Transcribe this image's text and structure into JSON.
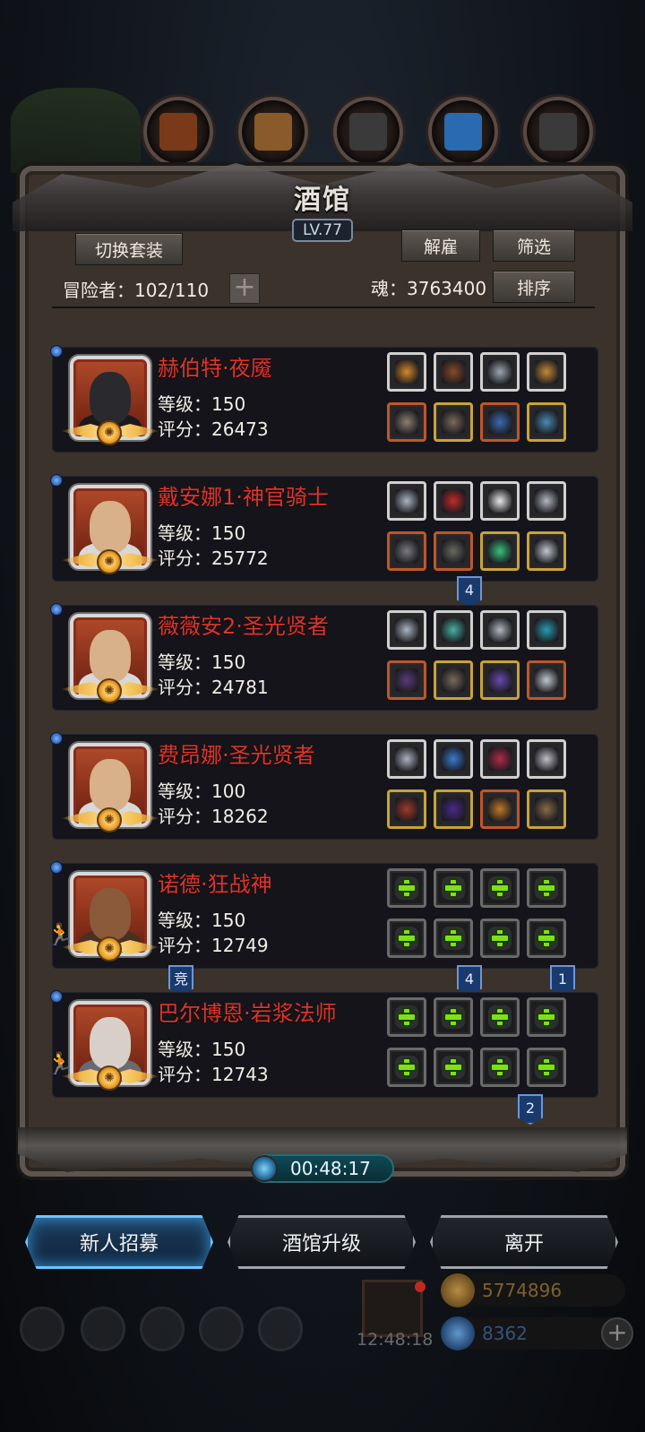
{
  "tavern": {
    "title": "酒馆",
    "level": "LV.77",
    "switch_outfit_label": "切换套装",
    "dismiss_label": "解雇",
    "filter_label": "筛选",
    "sort_label": "排序",
    "adventurers_label": "冒险者：102/110",
    "adventurers_current": 102,
    "adventurers_max": 110,
    "soul_label": "魂：3763400",
    "soul_value": 3763400
  },
  "heroes": [
    {
      "name": "赫伯特·夜魇",
      "level": "等级：150",
      "score": "评分：26473",
      "portrait": "masked-warrior",
      "equipment": [
        {
          "icon": "flame-helm-icon",
          "rarity": "white",
          "color": "#d48a2a"
        },
        {
          "icon": "armor-piece-icon",
          "rarity": "white",
          "color": "#8a4a2a"
        },
        {
          "icon": "crystal-ore-icon",
          "rarity": "white",
          "color": "#9aa6b0"
        },
        {
          "icon": "golden-staff-icon",
          "rarity": "white",
          "color": "#c48a3a"
        },
        {
          "icon": "curved-dagger-icon",
          "rarity": "red",
          "color": "#8a8070"
        },
        {
          "icon": "chest-armor-icon",
          "rarity": "yellow",
          "color": "#7a6a5a"
        },
        {
          "icon": "blue-blade-icon",
          "rarity": "red",
          "color": "#3a6ab0"
        },
        {
          "icon": "ring-icon",
          "rarity": "yellow",
          "color": "#4a8ab0"
        }
      ],
      "tags": []
    },
    {
      "name": "戴安娜1·神官骑士",
      "level": "等级：150",
      "score": "评分：25772",
      "portrait": "hooded-woman",
      "equipment": [
        {
          "icon": "silver-circlet-icon",
          "rarity": "white",
          "color": "#aab4c0"
        },
        {
          "icon": "red-orb-amulet-icon",
          "rarity": "white",
          "color": "#c02a2a"
        },
        {
          "icon": "white-wing-icon",
          "rarity": "white",
          "color": "#e8e8e8"
        },
        {
          "icon": "silver-dagger-icon",
          "rarity": "white",
          "color": "#b0b8c0"
        },
        {
          "icon": "war-hammer-icon",
          "rarity": "red",
          "color": "#7a7a80"
        },
        {
          "icon": "gauntlet-icon",
          "rarity": "red",
          "color": "#6a6a60"
        },
        {
          "icon": "emerald-ring-icon",
          "rarity": "yellow",
          "color": "#3ac07a"
        },
        {
          "icon": "pendant-icon",
          "rarity": "yellow",
          "color": "#c0c8d0"
        }
      ],
      "tags": [
        "4"
      ]
    },
    {
      "name": "薇薇安2·圣光贤者",
      "level": "等级：150",
      "score": "评分：24781",
      "portrait": "hooded-woman",
      "equipment": [
        {
          "icon": "silver-circlet-icon",
          "rarity": "white",
          "color": "#aab4c0"
        },
        {
          "icon": "teal-gem-icon",
          "rarity": "white",
          "color": "#4ab0a0"
        },
        {
          "icon": "silver-dagger-icon",
          "rarity": "white",
          "color": "#b0b8c0"
        },
        {
          "icon": "teal-bracer-icon",
          "rarity": "white",
          "color": "#2a9ab0"
        },
        {
          "icon": "purple-hood-icon",
          "rarity": "red",
          "color": "#5a3a7a"
        },
        {
          "icon": "chest-armor-icon",
          "rarity": "yellow",
          "color": "#7a6a5a"
        },
        {
          "icon": "purple-orb-icon",
          "rarity": "yellow",
          "color": "#6a4ab0"
        },
        {
          "icon": "pendant-icon",
          "rarity": "red",
          "color": "#c0c8d0"
        }
      ],
      "tags": []
    },
    {
      "name": "费昂娜·圣光贤者",
      "level": "等级：100",
      "score": "评分：18262",
      "portrait": "hooded-woman",
      "equipment": [
        {
          "icon": "silver-circlet-icon",
          "rarity": "white",
          "color": "#aab4c0"
        },
        {
          "icon": "blue-flame-icon",
          "rarity": "white",
          "color": "#3a7ad0"
        },
        {
          "icon": "red-shard-icon",
          "rarity": "white",
          "color": "#b02a4a"
        },
        {
          "icon": "star-emblem-icon",
          "rarity": "white",
          "color": "#c0c0c8"
        },
        {
          "icon": "red-axe-icon",
          "rarity": "yellow",
          "color": "#a03a2a"
        },
        {
          "icon": "purple-armor-icon",
          "rarity": "yellow",
          "color": "#4a2a8a"
        },
        {
          "icon": "fire-gauntlet-icon",
          "rarity": "red",
          "color": "#c07a2a"
        },
        {
          "icon": "bronze-ring-icon",
          "rarity": "yellow",
          "color": "#8a6a4a"
        }
      ],
      "tags": []
    },
    {
      "name": "诺德·狂战神",
      "level": "等级：150",
      "score": "评分：12749",
      "portrait": "bald-brute",
      "equipment": [
        {
          "icon": "empty-slot-plus-icon",
          "rarity": "empty"
        },
        {
          "icon": "empty-slot-plus-icon",
          "rarity": "empty"
        },
        {
          "icon": "empty-slot-plus-icon",
          "rarity": "empty"
        },
        {
          "icon": "empty-slot-plus-icon",
          "rarity": "empty"
        },
        {
          "icon": "empty-slot-plus-icon",
          "rarity": "empty"
        },
        {
          "icon": "empty-slot-plus-icon",
          "rarity": "empty"
        },
        {
          "icon": "empty-slot-plus-icon",
          "rarity": "empty"
        },
        {
          "icon": "empty-slot-plus-icon",
          "rarity": "empty"
        }
      ],
      "tags": [
        "竞",
        "4",
        "1"
      ]
    },
    {
      "name": "巴尔博恩·岩浆法师",
      "level": "等级：150",
      "score": "评分：12743",
      "portrait": "elf-mage",
      "equipment": [
        {
          "icon": "empty-slot-plus-icon",
          "rarity": "empty"
        },
        {
          "icon": "empty-slot-plus-icon",
          "rarity": "empty"
        },
        {
          "icon": "empty-slot-plus-icon",
          "rarity": "empty"
        },
        {
          "icon": "empty-slot-plus-icon",
          "rarity": "empty"
        },
        {
          "icon": "empty-slot-plus-icon",
          "rarity": "empty"
        },
        {
          "icon": "empty-slot-plus-icon",
          "rarity": "empty"
        },
        {
          "icon": "empty-slot-plus-icon",
          "rarity": "empty"
        },
        {
          "icon": "empty-slot-plus-icon",
          "rarity": "empty"
        }
      ],
      "tags": [
        "2"
      ]
    }
  ],
  "timer": "00:48:17",
  "actions": {
    "recruit_label": "新人招募",
    "upgrade_label": "酒馆升级",
    "leave_label": "离开"
  },
  "hud": {
    "gift_timer": "12:48:18",
    "gold": "5774896",
    "gems": "8362"
  },
  "colors": {
    "hero_name": "#e0342a",
    "accent_blue": "#6fc4ff",
    "gold": "#b8862a",
    "gem": "#2a6ab0"
  }
}
